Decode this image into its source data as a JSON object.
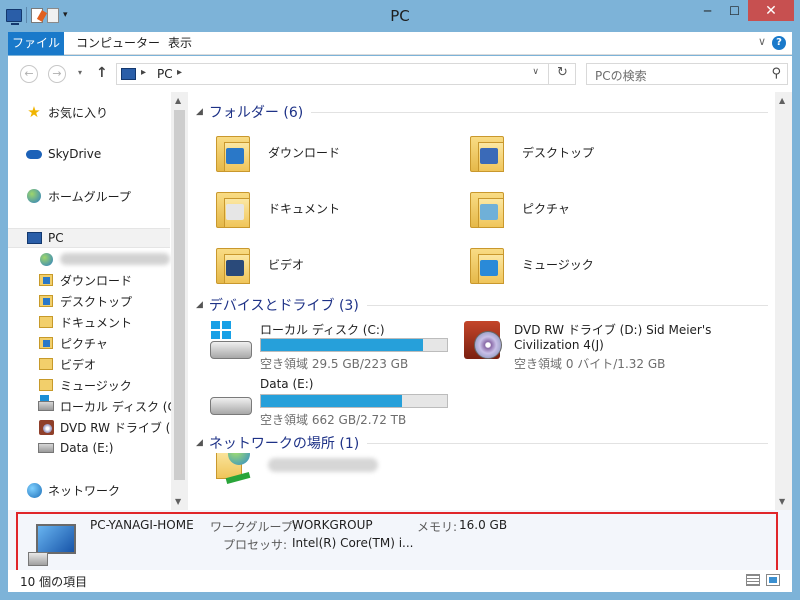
{
  "window": {
    "title": "PC",
    "close_symbol": "✕",
    "minimize_symbol": "─",
    "maximize_symbol": "☐"
  },
  "ribbon": {
    "tabs": [
      {
        "label": "ファイル"
      },
      {
        "label": "コンピューター"
      },
      {
        "label": "表示"
      }
    ],
    "expand_symbol": "∨",
    "help_symbol": "?"
  },
  "nav_bar": {
    "back": "←",
    "forward": "→",
    "recent": "▾",
    "up": "↑",
    "address_sep": "▸",
    "address_path": "PC",
    "address_drop": "∨",
    "refresh": "↻",
    "search_placeholder": "PCの検索",
    "search_icon": "⚲"
  },
  "nav_pane": {
    "items": [
      {
        "label": "お気に入り",
        "icon": "star-icon"
      },
      {
        "label": "SkyDrive",
        "icon": "cloud-icon"
      },
      {
        "label": "ホームグループ",
        "icon": "homegroup-icon"
      },
      {
        "label": "PC",
        "icon": "pc-icon"
      },
      {
        "label": "",
        "icon": "user-folder-icon"
      },
      {
        "label": "ダウンロード",
        "icon": "folder-icon"
      },
      {
        "label": "デスクトップ",
        "icon": "folder-icon"
      },
      {
        "label": "ドキュメント",
        "icon": "folder-icon"
      },
      {
        "label": "ピクチャ",
        "icon": "folder-icon"
      },
      {
        "label": "ビデオ",
        "icon": "folder-icon"
      },
      {
        "label": "ミュージック",
        "icon": "folder-icon"
      },
      {
        "label": "ローカル ディスク (C:)",
        "icon": "drive-icon"
      },
      {
        "label": "DVD RW ドライブ (D:",
        "icon": "dvd-icon"
      },
      {
        "label": "Data (E:)",
        "icon": "drive-icon"
      },
      {
        "label": "ネットワーク",
        "icon": "network-icon"
      }
    ]
  },
  "groups": {
    "folders": {
      "header": "フォルダー (6)"
    },
    "devices": {
      "header": "デバイスとドライブ (3)"
    },
    "network": {
      "header": "ネットワークの場所 (1)"
    }
  },
  "folders": [
    {
      "label": "ダウンロード",
      "badge_color": "#2a78c8"
    },
    {
      "label": "デスクトップ",
      "badge_color": "#3a6ab8"
    },
    {
      "label": "ドキュメント",
      "badge_color": "#e6e6e6"
    },
    {
      "label": "ピクチャ",
      "badge_color": "#6fb0d8"
    },
    {
      "label": "ビデオ",
      "badge_color": "#2a4a7a"
    },
    {
      "label": "ミュージック",
      "badge_color": "#2a8ad8"
    }
  ],
  "drives": [
    {
      "name": "ローカル ディスク (C:)",
      "free_text": "空き領域 29.5 GB/223 GB",
      "used_fraction": 0.87
    },
    {
      "name_line1": "DVD RW ドライブ (D:) Sid Meier's",
      "name_line2": "Civilization 4(J)",
      "free_text": "空き領域 0 バイト/1.32 GB"
    },
    {
      "name": "Data (E:)",
      "free_text": "空き領域 662 GB/2.72 TB",
      "used_fraction": 0.76
    }
  ],
  "network_items": [
    {
      "label": ""
    }
  ],
  "details": {
    "computer_name": "PC-YANAGI-HOME",
    "workgroup_label": "ワークグループ:",
    "workgroup_value": "WORKGROUP",
    "memory_label": "メモリ:",
    "memory_value": "16.0 GB",
    "processor_label": "プロセッサ:",
    "processor_value": "Intel(R) Core(TM) i..."
  },
  "status_bar": {
    "item_count": "10 個の項目"
  },
  "colors": {
    "accent": "#1979ca",
    "progress": "#26a0da",
    "highlight_box": "#e0262a",
    "group_header": "#1e3287"
  }
}
